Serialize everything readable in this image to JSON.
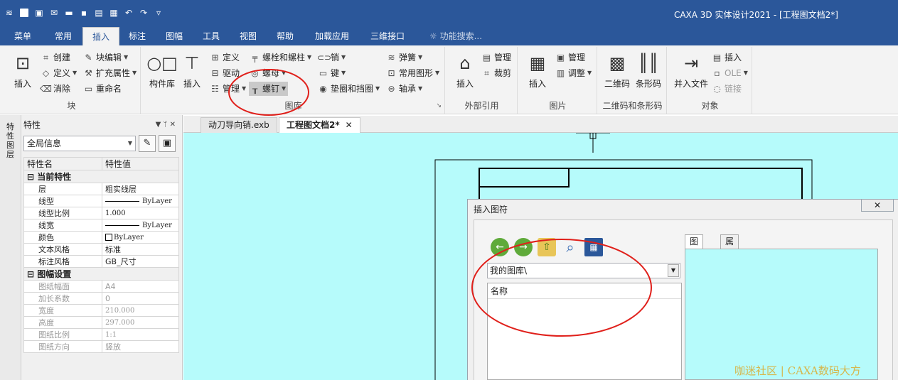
{
  "window": {
    "title": "CAXA 3D 实体设计2021 - [工程图文档2*]"
  },
  "quick_access": [
    "layers-icon",
    "new-icon",
    "open-icon",
    "mail-icon",
    "folder-icon",
    "save-icon",
    "saveas-icon",
    "print-icon",
    "undo-icon",
    "redo-icon",
    "customize-icon"
  ],
  "tabs": [
    "菜单",
    "常用",
    "插入",
    "标注",
    "图幅",
    "工具",
    "视图",
    "帮助",
    "加载应用",
    "三维接口"
  ],
  "active_tab": "插入",
  "tab_search": "功能搜索...",
  "ribbon": {
    "block": {
      "label": "块",
      "insert": "插入",
      "create": "创建",
      "define": "定义",
      "eliminate": "消除",
      "block_edit": "块编辑",
      "ext_attr": "扩充属性",
      "rename": "重命名"
    },
    "library": {
      "label": "图库",
      "component_lib": "构件库",
      "insert": "插入",
      "define": "定义",
      "drive": "驱动",
      "manage": "管理",
      "bolt_stud": "螺栓和螺柱",
      "nut": "螺母",
      "screw": "螺钉",
      "pin": "销",
      "key": "键",
      "washer": "垫圈和挡圈",
      "spring": "弹簧",
      "common_shape": "常用图形",
      "bearing": "轴承"
    },
    "xref": {
      "label": "外部引用",
      "insert": "插入",
      "manage": "管理",
      "crop": "裁剪"
    },
    "image": {
      "label": "图片",
      "insert": "插入",
      "manage": "管理",
      "adjust": "调整"
    },
    "codes": {
      "label": "二维码和条形码",
      "qrcode": "二维码",
      "barcode": "条形码"
    },
    "object": {
      "label": "对象",
      "merge_file": "并入文件",
      "insert": "插入",
      "ole": "OLE",
      "link": "链接"
    }
  },
  "properties_panel": {
    "vertical_tab": "特性 图层",
    "title": "特性",
    "controls": "▼ ᛘ ✕",
    "selector": "全局信息",
    "col_name": "特性名",
    "col_value": "特性值",
    "section_current": "当前特性",
    "current": [
      {
        "name": "层",
        "value": "粗实线层"
      },
      {
        "name": "线型",
        "value": "ByLayer"
      },
      {
        "name": "线型比例",
        "value": "1.000"
      },
      {
        "name": "线宽",
        "value": "ByLayer"
      },
      {
        "name": "颜色",
        "value": "ByLayer"
      },
      {
        "name": "文本风格",
        "value": "标准"
      },
      {
        "name": "标注风格",
        "value": "GB_尺寸"
      }
    ],
    "section_sheet": "图幅设置",
    "sheet": [
      {
        "name": "图纸幅面",
        "value": "A4"
      },
      {
        "name": "加长系数",
        "value": "0"
      },
      {
        "name": "宽度",
        "value": "210.000"
      },
      {
        "name": "高度",
        "value": "297.000"
      },
      {
        "name": "图纸比例",
        "value": "1:1"
      },
      {
        "name": "图纸方向",
        "value": "竖放"
      }
    ]
  },
  "doc_tabs": [
    {
      "label": "动刀导向销.exb",
      "active": false
    },
    {
      "label": "工程图文档2*",
      "active": true
    }
  ],
  "dialog": {
    "title": "插入图符",
    "path": "我的图库\\",
    "list_header": "名称",
    "tabs": [
      "图形",
      "属性"
    ]
  },
  "watermark": "咖迷社区 | CAXA数码大方",
  "colors": {
    "title_bar": "#2b579a",
    "canvas": "#b6fbfb",
    "annotation": "#e0201b"
  }
}
